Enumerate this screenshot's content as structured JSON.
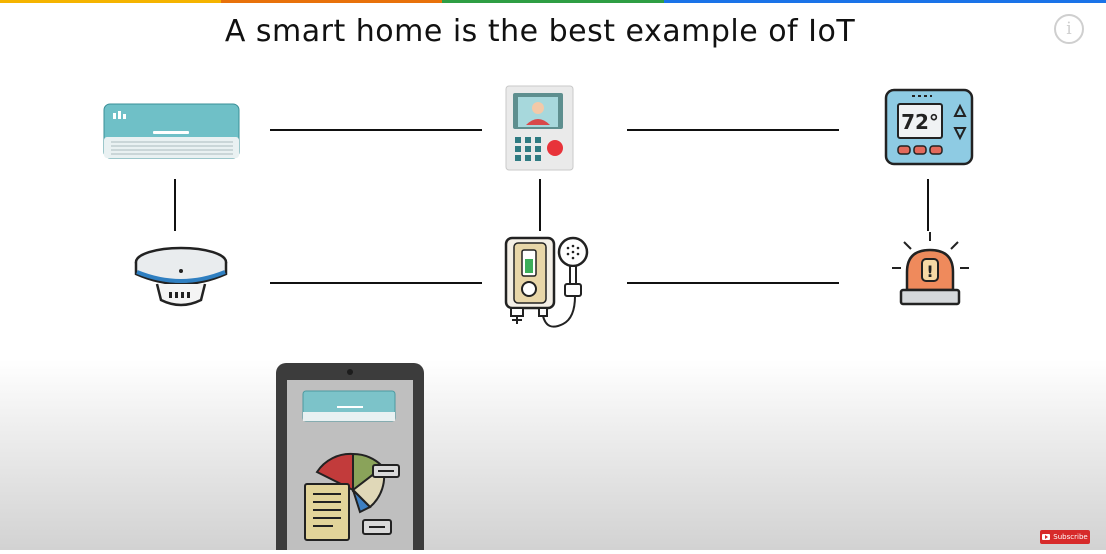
{
  "header": {
    "title": "A smart home is the best example of IoT",
    "info_symbol": "i",
    "accent_colors": [
      "#f5b400",
      "#e8710a",
      "#2f9e44",
      "#1a73e8",
      "#1a73e8"
    ]
  },
  "devices": [
    {
      "name": "air-conditioner",
      "icon": "air-conditioner-icon"
    },
    {
      "name": "video-intercom",
      "icon": "video-intercom-icon"
    },
    {
      "name": "thermostat",
      "icon": "thermostat-icon",
      "display": "72°"
    },
    {
      "name": "smoke-detector",
      "icon": "smoke-detector-icon"
    },
    {
      "name": "water-heater",
      "icon": "water-heater-shower-icon"
    },
    {
      "name": "alarm",
      "icon": "alarm-siren-icon",
      "symbol": "!"
    },
    {
      "name": "tablet",
      "icon": "tablet-controller-icon"
    }
  ],
  "footer": {
    "subscribe_label": "Subscribe"
  }
}
